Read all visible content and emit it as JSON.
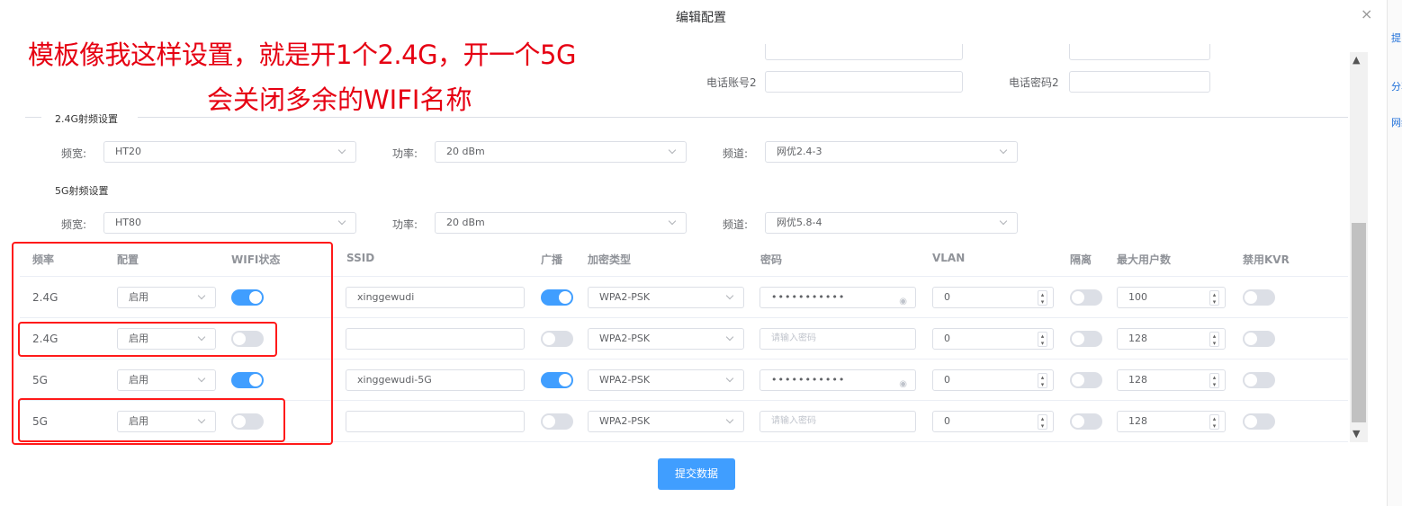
{
  "dialog": {
    "title": "编辑配置",
    "close": "×"
  },
  "edge_texts": [
    "提",
    "分享",
    "网络"
  ],
  "annotation": {
    "line1": "模板像我这样设置，就是开1个2.4G，开一个5G",
    "line2": "会关闭多余的WIFI名称"
  },
  "phone": {
    "account2_label": "电话账号2",
    "password2_label": "电话密码2",
    "account2_value": "",
    "password2_value": ""
  },
  "radio24": {
    "section_title": "2.4G射频设置",
    "bandwidth_label": "频宽:",
    "bandwidth_value": "HT20",
    "power_label": "功率:",
    "power_value": "20 dBm",
    "channel_label": "频道:",
    "channel_value": "网优2.4-3"
  },
  "radio5": {
    "section_title": "5G射频设置",
    "bandwidth_label": "频宽:",
    "bandwidth_value": "HT80",
    "power_label": "功率:",
    "power_value": "20 dBm",
    "channel_label": "频道:",
    "channel_value": "网优5.8-4"
  },
  "table": {
    "headers": [
      "频率",
      "配置",
      "WIFI状态",
      "SSID",
      "广播",
      "加密类型",
      "密码",
      "VLAN",
      "隔离",
      "最大用户数",
      "禁用KVR"
    ],
    "password_placeholder": "请输入密码",
    "rows": [
      {
        "freq": "2.4G",
        "config": "启用",
        "wifi_on": true,
        "ssid": "xinggewudi",
        "broadcast_on": true,
        "encryption": "WPA2-PSK",
        "password": "•••••••••••",
        "vlan": "0",
        "isolate_on": false,
        "max_users": "100",
        "kvr_on": false
      },
      {
        "freq": "2.4G",
        "config": "启用",
        "wifi_on": false,
        "ssid": "",
        "broadcast_on": false,
        "encryption": "WPA2-PSK",
        "password": "",
        "vlan": "0",
        "isolate_on": false,
        "max_users": "128",
        "kvr_on": false
      },
      {
        "freq": "5G",
        "config": "启用",
        "wifi_on": true,
        "ssid": "xinggewudi-5G",
        "broadcast_on": true,
        "encryption": "WPA2-PSK",
        "password": "•••••••••••",
        "vlan": "0",
        "isolate_on": false,
        "max_users": "128",
        "kvr_on": false
      },
      {
        "freq": "5G",
        "config": "启用",
        "wifi_on": false,
        "ssid": "",
        "broadcast_on": false,
        "encryption": "WPA2-PSK",
        "password": "",
        "vlan": "0",
        "isolate_on": false,
        "max_users": "128",
        "kvr_on": false
      }
    ]
  },
  "submit_label": "提交数据",
  "colors": {
    "primary": "#409eff",
    "annotation_red": "#e60012",
    "box_red": "#ff1a1a"
  }
}
